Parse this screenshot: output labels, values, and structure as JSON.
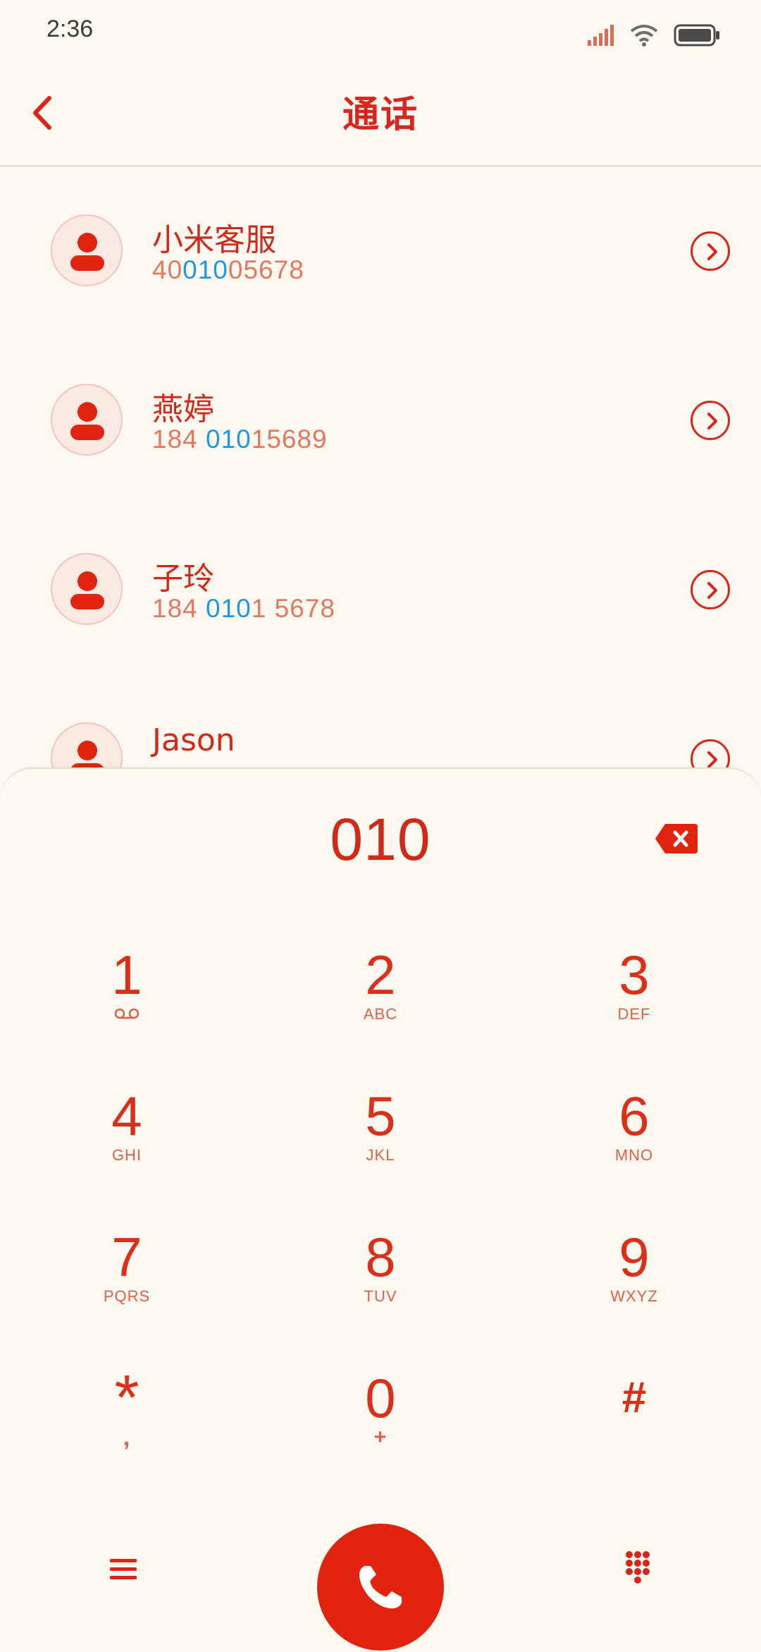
{
  "status": {
    "time": "2:36"
  },
  "header": {
    "title": "通话"
  },
  "contacts": [
    {
      "name": "小米客服",
      "number_parts": [
        "40",
        "010",
        "05678"
      ]
    },
    {
      "name": "燕婷",
      "number_parts": [
        "184 ",
        "010",
        "15689"
      ]
    },
    {
      "name": "子玲",
      "number_parts": [
        "184 ",
        "010",
        "1 5678"
      ]
    },
    {
      "name": "Jason",
      "number_parts": [
        "",
        "",
        ""
      ]
    }
  ],
  "dialpad": {
    "input": "010",
    "keys": [
      {
        "digit": "1",
        "letters": ""
      },
      {
        "digit": "2",
        "letters": "ABC"
      },
      {
        "digit": "3",
        "letters": "DEF"
      },
      {
        "digit": "4",
        "letters": "GHI"
      },
      {
        "digit": "5",
        "letters": "JKL"
      },
      {
        "digit": "6",
        "letters": "MNO"
      },
      {
        "digit": "7",
        "letters": "PQRS"
      },
      {
        "digit": "8",
        "letters": "TUV"
      },
      {
        "digit": "9",
        "letters": "WXYZ"
      },
      {
        "digit": "*",
        "letters": ","
      },
      {
        "digit": "0",
        "letters": "+"
      },
      {
        "digit": "#",
        "letters": ""
      }
    ]
  },
  "icons": {
    "back": "chevron-left-icon",
    "detail": "chevron-right-circle-icon",
    "backspace": "backspace-icon",
    "voicemail": "voicemail-icon",
    "menu": "menu-icon",
    "call": "phone-icon",
    "dialpad": "dialpad-icon"
  },
  "colors": {
    "accent": "#dd2a17",
    "highlight": "#1f97e3",
    "background": "#fdf9f1"
  }
}
